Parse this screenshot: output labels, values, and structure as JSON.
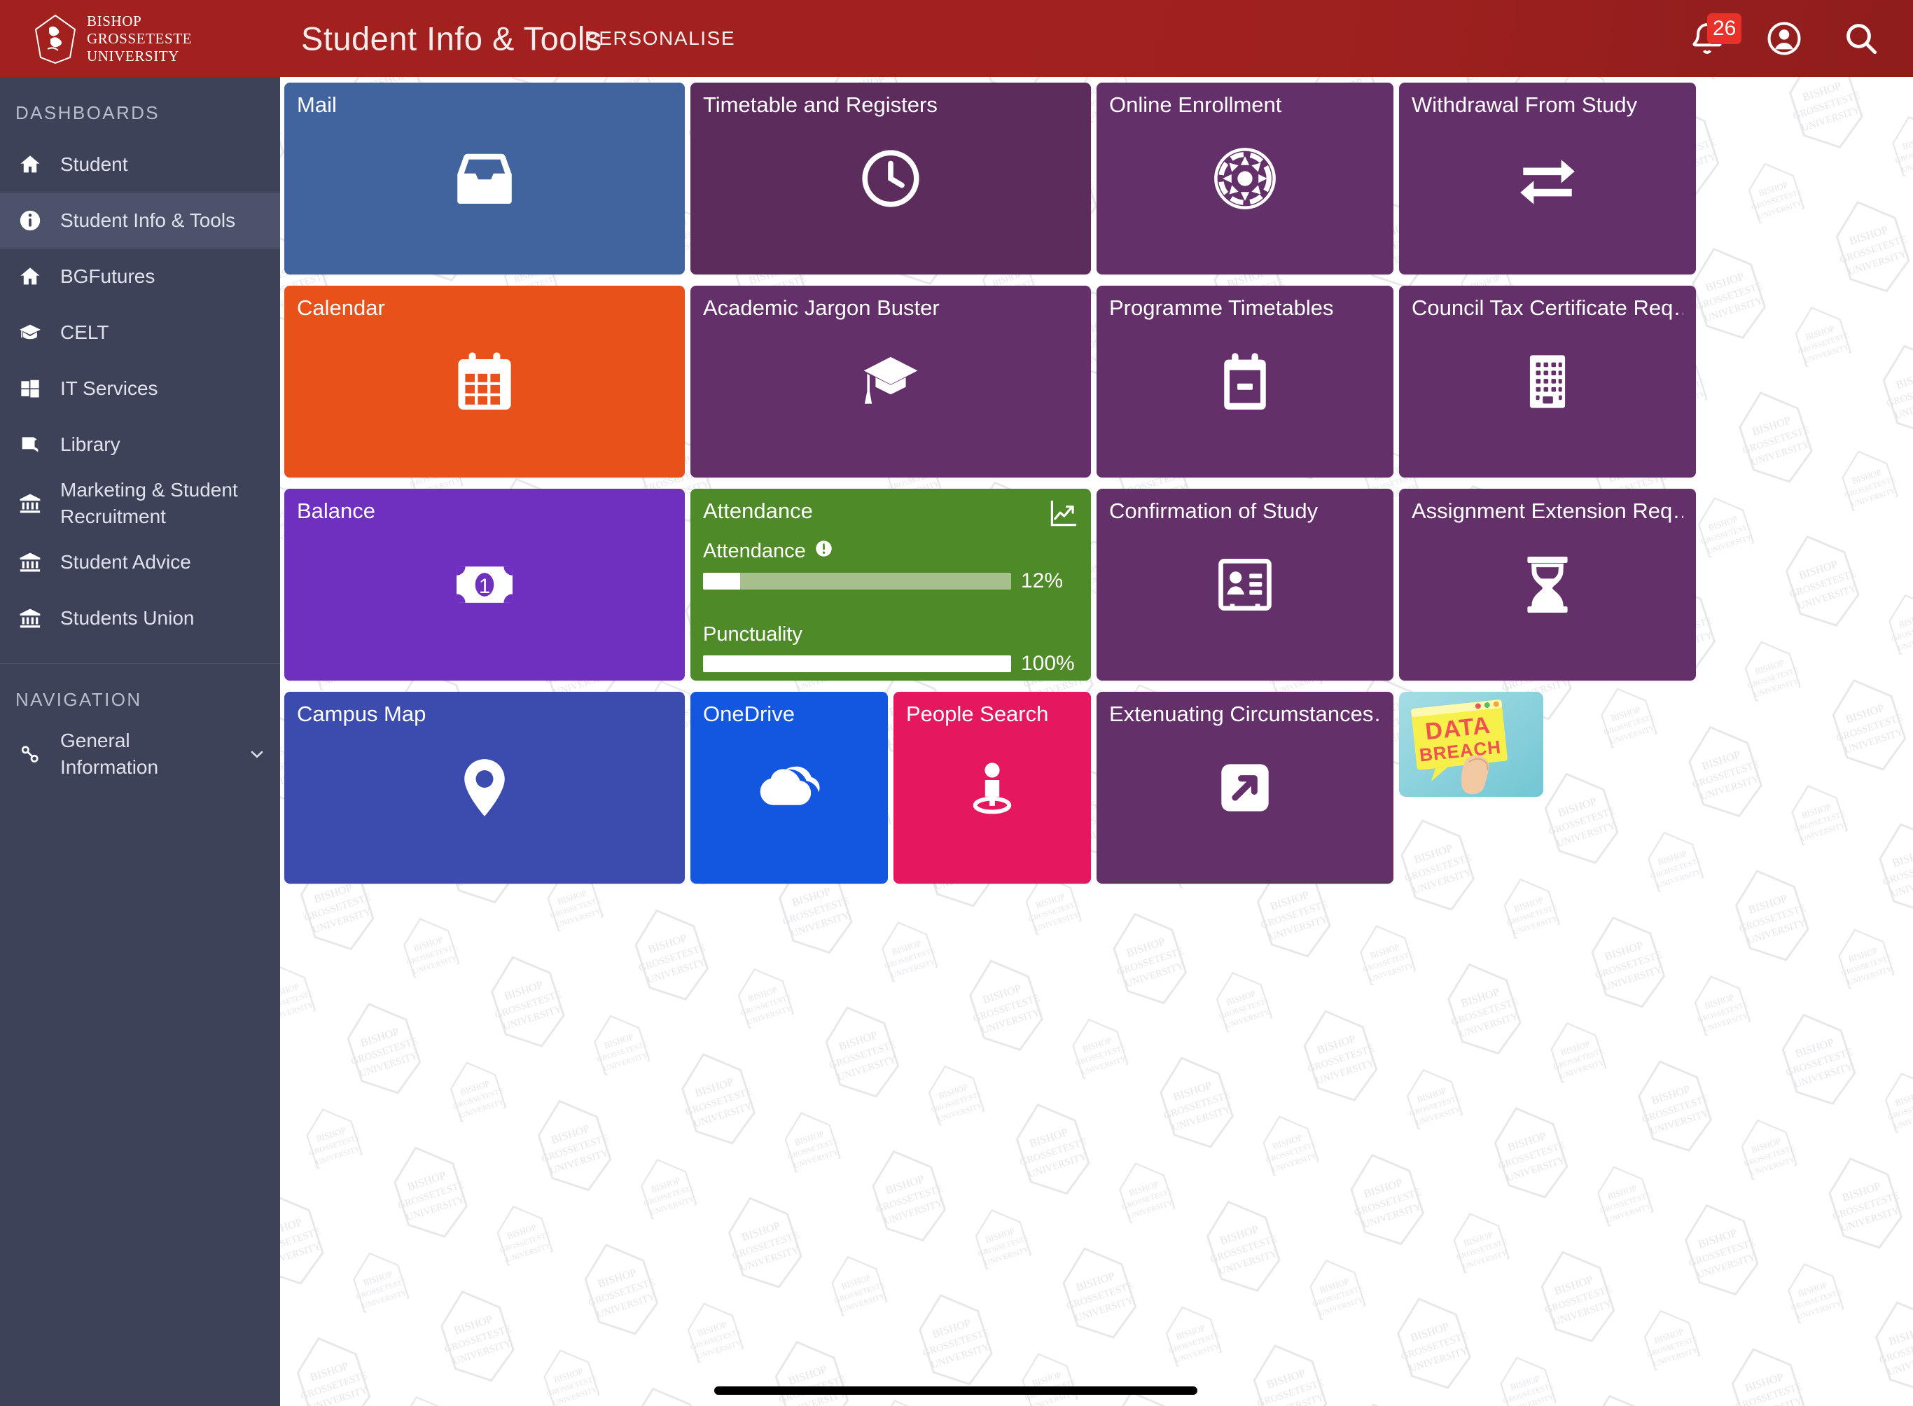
{
  "brand": {
    "logo_line1": "BISHOP",
    "logo_line2": "GROSSETESTE",
    "logo_line3": "UNIVERSITY",
    "header_color": "#a2211f",
    "sidebar_color": "#3d4258"
  },
  "header": {
    "title": "Student Info & Tools",
    "personalise_label": "PERSONALISE",
    "notifications_count": "26",
    "icons": [
      "bell-icon",
      "account-icon",
      "search-icon"
    ]
  },
  "sidebar": {
    "section_dashboards": "DASHBOARDS",
    "section_navigation": "NAVIGATION",
    "dashboards": [
      {
        "label": "Student",
        "icon": "home-icon",
        "active": false
      },
      {
        "label": "Student Info & Tools",
        "icon": "info-circle-icon",
        "active": true
      },
      {
        "label": "BGFutures",
        "icon": "home-icon",
        "active": false
      },
      {
        "label": "CELT",
        "icon": "graduation-cap-icon",
        "active": false
      },
      {
        "label": "IT Services",
        "icon": "windows-icon",
        "active": false
      },
      {
        "label": "Library",
        "icon": "book-icon",
        "active": false
      },
      {
        "label": "Marketing & Student Recruitment",
        "icon": "bank-icon",
        "active": false
      },
      {
        "label": "Student Advice",
        "icon": "bank-icon",
        "active": false
      },
      {
        "label": "Students Union",
        "icon": "bank-icon",
        "active": false
      }
    ],
    "navigation": [
      {
        "label": "General Information",
        "icon": "link-icon",
        "expandable": true
      }
    ]
  },
  "tiles": [
    {
      "title": "Mail",
      "icon": "inbox-icon",
      "color": "#41639e",
      "span": 1
    },
    {
      "title": "Timetable and Registers",
      "icon": "clock-icon",
      "color": "#5c2d5c",
      "span": 1
    },
    {
      "title": "Online Enrollment",
      "icon": "cog-icon",
      "color": "#63306a",
      "span": 1
    },
    {
      "title": "Withdrawal From Study",
      "icon": "exchange-arrows-icon",
      "color": "#63306a",
      "span": 1
    },
    {
      "title": "Calendar",
      "icon": "calendar-icon",
      "color": "#e9511b",
      "span": 1
    },
    {
      "title": "Academic Jargon Buster",
      "icon": "graduation-cap-icon",
      "color": "#63306a",
      "span": 1
    },
    {
      "title": "Programme Timetables",
      "icon": "note-minus-icon",
      "color": "#63306a",
      "span": 1
    },
    {
      "title": "Council Tax Certificate Req…",
      "icon": "building-icon",
      "color": "#63306a",
      "span": 1
    },
    {
      "title": "Balance",
      "icon": "banknote-icon",
      "color": "#6f30c0",
      "span": 1
    },
    {
      "title": "Attendance",
      "icon": "chart-line-icon",
      "color": "#4f8a28",
      "span": 1,
      "type": "attendance"
    },
    {
      "title": "Confirmation of Study",
      "icon": "id-card-icon",
      "color": "#63306a",
      "span": 1
    },
    {
      "title": "Assignment Extension Req…",
      "icon": "hourglass-icon",
      "color": "#63306a",
      "span": 1
    },
    {
      "title": "Campus Map",
      "icon": "map-pin-icon",
      "color": "#3c4cae",
      "span": 1
    },
    {
      "title": "OneDrive",
      "icon": "cloud-icon",
      "color": "#1356e0",
      "span": 0.5
    },
    {
      "title": "People Search",
      "icon": "person-locator-icon",
      "color": "#e5175e",
      "span": 0.5
    },
    {
      "title": "Extenuating Circumstances…",
      "icon": "arrow-out-box-icon",
      "color": "#63306a",
      "span": 1
    },
    {
      "title": "",
      "icon": "data-breach-image",
      "color": "#8fd3dd",
      "span": 0.35,
      "type": "image"
    }
  ],
  "attendance": {
    "tile_title": "Attendance",
    "graph_icon": "chart-line-icon",
    "rows": [
      {
        "label": "Attendance",
        "value": "12%",
        "percent": 12,
        "warning": true,
        "warning_icon": "exclamation-circle-icon"
      },
      {
        "label": "Punctuality",
        "value": "100%",
        "percent": 100,
        "warning": false
      }
    ]
  },
  "data_breach_tile": {
    "text_line1": "DATA",
    "text_line2": "BREACH"
  },
  "scrollbar": {
    "orientation": "horizontal"
  }
}
